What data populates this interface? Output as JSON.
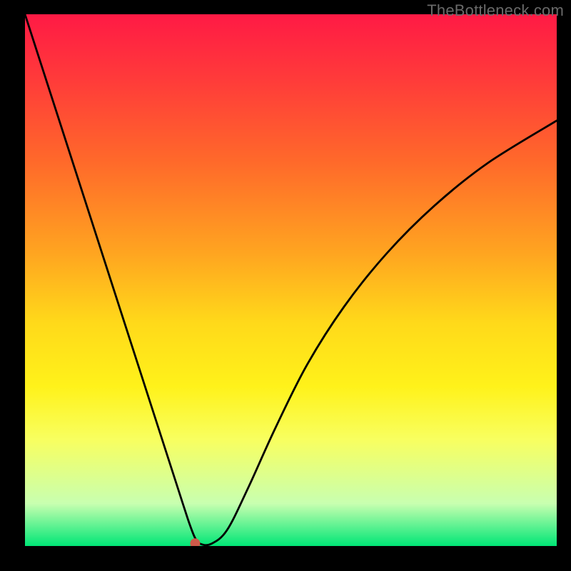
{
  "watermark": "TheBottleneck.com",
  "colors": {
    "background": "#000000",
    "curve": "#000000",
    "marker": "#cf5a4a"
  },
  "chart_data": {
    "type": "line",
    "title": "",
    "xlabel": "",
    "ylabel": "",
    "xlim": [
      0,
      100
    ],
    "ylim": [
      0,
      100
    ],
    "series": [
      {
        "name": "curve",
        "x": [
          0,
          5,
          10,
          15,
          20,
          24,
          27,
          29,
          30,
          31,
          32,
          33,
          35,
          38,
          42,
          47,
          53,
          60,
          68,
          77,
          87,
          100
        ],
        "y": [
          100,
          84.5,
          69,
          53.5,
          38,
          25.6,
          16.3,
          10.1,
          7,
          4,
          1.5,
          0.4,
          0.4,
          3,
          11,
          22,
          34,
          45,
          55,
          64,
          72,
          80
        ]
      }
    ],
    "marker": {
      "x": 32,
      "y": 0.5
    },
    "gradient_stops": [
      {
        "pos": 0,
        "color": "#ff1a45"
      },
      {
        "pos": 12,
        "color": "#ff3a3a"
      },
      {
        "pos": 28,
        "color": "#ff6a2a"
      },
      {
        "pos": 45,
        "color": "#ffa520"
      },
      {
        "pos": 58,
        "color": "#ffd91a"
      },
      {
        "pos": 70,
        "color": "#fff21a"
      },
      {
        "pos": 80,
        "color": "#f8ff60"
      },
      {
        "pos": 92,
        "color": "#c8ffb0"
      },
      {
        "pos": 100,
        "color": "#00e676"
      }
    ]
  }
}
